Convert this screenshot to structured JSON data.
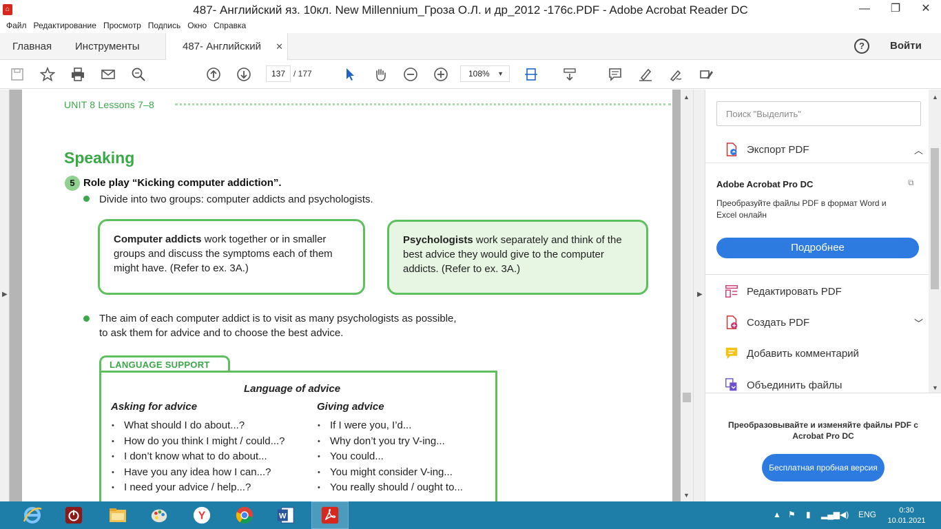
{
  "window": {
    "title": "487- Английский яз. 10кл. New Millennium_Гроза О.Л. и др_2012 -176с.PDF - Adobe Acrobat Reader DC",
    "controls": {
      "minimize": "—",
      "maximize": "❐",
      "close": "✕"
    }
  },
  "menu": [
    "Файл",
    "Редактирование",
    "Просмотр",
    "Подпись",
    "Окно",
    "Справка"
  ],
  "tabs": {
    "home": "Главная",
    "tools": "Инструменты",
    "document": "487- Английский яз...",
    "close": "✕",
    "help": "?",
    "signin": "Войти"
  },
  "toolbar": {
    "page_current": "137",
    "page_total": "/   177",
    "zoom": "108%",
    "zoom_caret": "▼"
  },
  "document": {
    "unit_header": "UNIT 8  Lessons 7–8",
    "section_title": "Speaking",
    "exercise_number": "5",
    "exercise_title": "Role play “Kicking computer addiction”.",
    "bullet1": "Divide into two groups: computer addicts and psychologists.",
    "card_a_bold": "Computer addicts",
    "card_a_text": " work together or in smaller groups and discuss the symptoms each of them might have. (Refer to ex. 3A.)",
    "card_b_bold": "Psychologists",
    "card_b_text": " work separately and think of the best advice they would give to the computer addicts. (Refer to ex. 3A.)",
    "bullet2_line1": "The aim of each computer addict is to visit as many psychologists as possible,",
    "bullet2_line2": "to ask them for advice and to choose the best advice.",
    "language_support": "LANGUAGE SUPPORT",
    "language_heading": "Language of advice",
    "asking_title": "Asking for advice",
    "asking": [
      "What should I do about...?",
      "How do you think I might / could...?",
      "I don’t know what to do about...",
      "Have you any idea how I can...?",
      "I need your advice / help...?"
    ],
    "giving_title": "Giving advice",
    "giving": [
      "If I were you, I’d...",
      "Why don’t you try V-ing...",
      "You could...",
      "You might consider V-ing...",
      "You really should / ought to..."
    ]
  },
  "right_panel": {
    "search_placeholder": "Поиск \"Выделить\"",
    "export_pdf": "Экспорт PDF",
    "promo_title": "Adobe Acrobat Pro DC",
    "promo_desc": "Преобразуйте файлы PDF в формат Word и Excel онлайн",
    "more_button": "Подробнее",
    "tools": [
      "Редактировать PDF",
      "Создать PDF",
      "Добавить комментарий",
      "Объединить файлы"
    ],
    "bottom_msg": "Преобразовывайте и изменяйте файлы PDF с Acrobat Pro DC",
    "trial_button": "Бесплатная пробная версия"
  },
  "taskbar": {
    "lang": "ENG",
    "time": "0:30",
    "date": "10.01.2021"
  },
  "colors": {
    "accent_green": "#3aa847",
    "card_border": "#5dbf5d",
    "acrobat_blue": "#2d7be0",
    "taskbar": "#1e7ea8"
  }
}
